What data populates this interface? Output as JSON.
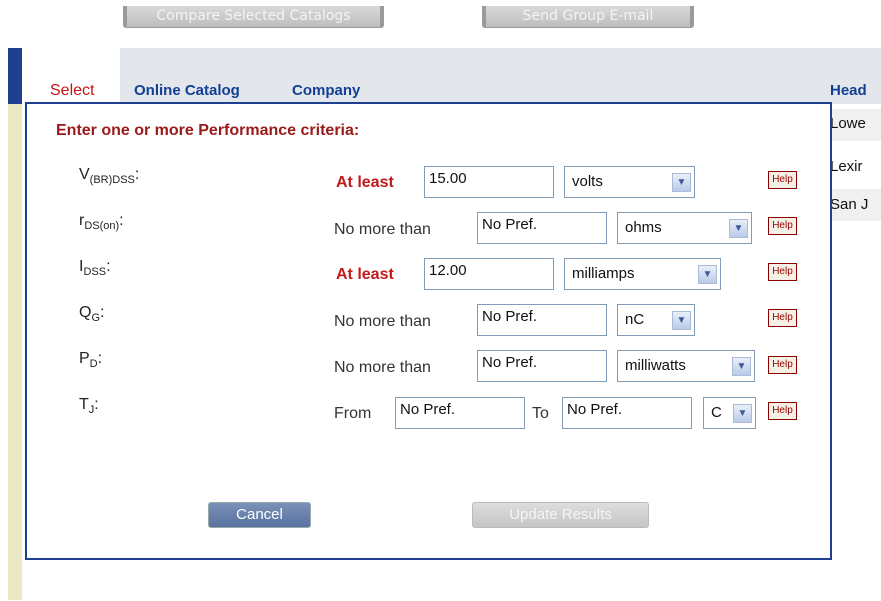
{
  "toolbar": {
    "compare_label": "Compare Selected Catalogs",
    "email_label": "Send Group E-mail"
  },
  "table": {
    "headers": [
      "Select",
      "Online Catalog",
      "Company",
      "Head"
    ],
    "right_cells": [
      "Lowe",
      "Lexir",
      "San J"
    ]
  },
  "dialog": {
    "title": "Enter one or more Performance criteria:",
    "rows": [
      {
        "param_main": "V",
        "param_sub": "(BR)DSS",
        "qualifier": "At least",
        "qualifier_red": true,
        "value": "15.00",
        "unit": "volts",
        "help": "Help"
      },
      {
        "param_main": "r",
        "param_sub": "DS(on)",
        "qualifier": "No more than",
        "qualifier_red": false,
        "value": "No Pref.",
        "unit": "ohms",
        "help": "Help"
      },
      {
        "param_main": "I",
        "param_sub": "DSS",
        "qualifier": "At least",
        "qualifier_red": true,
        "value": "12.00",
        "unit": "milliamps",
        "help": "Help"
      },
      {
        "param_main": "Q",
        "param_sub": "G",
        "qualifier": "No more than",
        "qualifier_red": false,
        "value": "No Pref.",
        "unit": "nC",
        "help": "Help"
      },
      {
        "param_main": "P",
        "param_sub": "D",
        "qualifier": "No more than",
        "qualifier_red": false,
        "value": "No Pref.",
        "unit": "milliwatts",
        "help": "Help"
      },
      {
        "param_main": "T",
        "param_sub": "J",
        "qualifier": "From",
        "qualifier_red": false,
        "value": "No Pref.",
        "to_label": "To",
        "value2": "No Pref.",
        "unit": "C",
        "help": "Help"
      }
    ],
    "cancel_label": "Cancel",
    "update_label": "Update Results"
  },
  "colors": {
    "accent_blue": "#1f3f8f",
    "title_red": "#9a1a1a",
    "qualifier_red": "#c11a1a"
  }
}
